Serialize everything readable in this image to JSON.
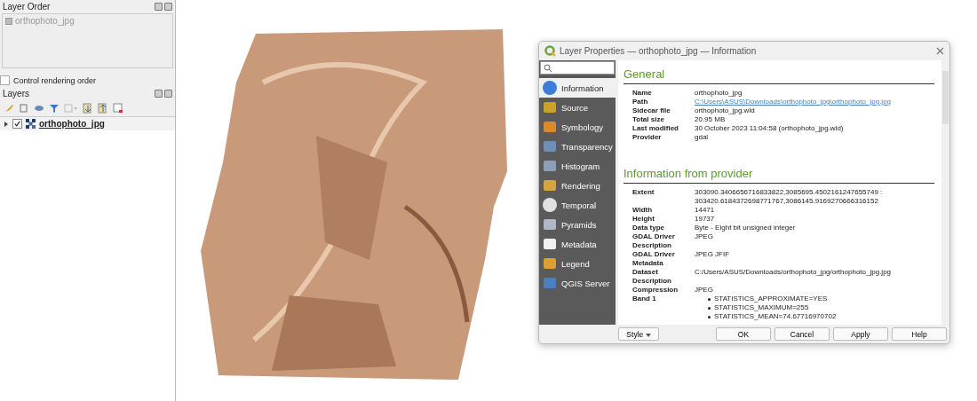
{
  "layer_order": {
    "title": "Layer Order",
    "items": [
      {
        "label": "orthophoto_jpg",
        "disabled": true
      }
    ],
    "control_rendering_order": {
      "label": "Control rendering order",
      "checked": false
    }
  },
  "layers": {
    "title": "Layers",
    "items": [
      {
        "label": "orthophoto_jpg",
        "checked": true,
        "expanded": false
      }
    ]
  },
  "dialog": {
    "title": "Layer Properties — orthophoto_jpg — Information",
    "nav": [
      {
        "label": "Information",
        "selected": true
      },
      {
        "label": "Source",
        "selected": false
      },
      {
        "label": "Symbology",
        "selected": false
      },
      {
        "label": "Transparency",
        "selected": false
      },
      {
        "label": "Histogram",
        "selected": false
      },
      {
        "label": "Rendering",
        "selected": false
      },
      {
        "label": "Temporal",
        "selected": false
      },
      {
        "label": "Pyramids",
        "selected": false
      },
      {
        "label": "Metadata",
        "selected": false
      },
      {
        "label": "Legend",
        "selected": false
      },
      {
        "label": "QGIS Server",
        "selected": false
      }
    ],
    "sections": [
      {
        "heading": "General",
        "rows": [
          {
            "label": "Name",
            "kind": "text",
            "value": "orthophoto_jpg"
          },
          {
            "label": "Path",
            "kind": "link",
            "value": "C:\\Users\\ASUS\\Downloads\\orthophoto_jpg\\orthophoto_jpg.jpg"
          },
          {
            "label": "Sidecar file",
            "kind": "text",
            "value": "orthophoto_jpg.wld"
          },
          {
            "label": "Total size",
            "kind": "text",
            "value": "20.95 MB"
          },
          {
            "label": "Last modified",
            "kind": "text",
            "value": "30 October 2023 11:04:58 (orthophoto_jpg.wld)"
          },
          {
            "label": "Provider",
            "kind": "text",
            "value": "gdal"
          }
        ]
      },
      {
        "heading": "Information from provider",
        "rows": [
          {
            "label": "Extent",
            "kind": "text",
            "value": "303090.3406656716833822,3085695.4502161247655749 : 303420.6184372698771767,3086145.9169270666316152"
          },
          {
            "label": "Width",
            "kind": "text",
            "value": "14471"
          },
          {
            "label": "Height",
            "kind": "text",
            "value": "19737"
          },
          {
            "label": "Data type",
            "kind": "text",
            "value": "Byte - Eight bit unsigned integer"
          },
          {
            "label": "GDAL Driver Description",
            "kind": "text",
            "value": "JPEG"
          },
          {
            "label": "GDAL Driver Metadata",
            "kind": "text",
            "value": "JPEG JFIF"
          },
          {
            "label": "Dataset Description",
            "kind": "text",
            "value": "C:/Users/ASUS/Downloads/orthophoto_jpg/orthophoto_jpg.jpg"
          },
          {
            "label": "Compression",
            "kind": "text",
            "value": "JPEG"
          },
          {
            "label": "Band 1",
            "kind": "list",
            "items": [
              "STATISTICS_APPROXIMATE=YES",
              "STATISTICS_MAXIMUM=255",
              "STATISTICS_MEAN=74.67716970702"
            ]
          }
        ]
      }
    ],
    "style_button": "Style",
    "buttons": [
      "OK",
      "Cancel",
      "Apply",
      "Help"
    ]
  }
}
